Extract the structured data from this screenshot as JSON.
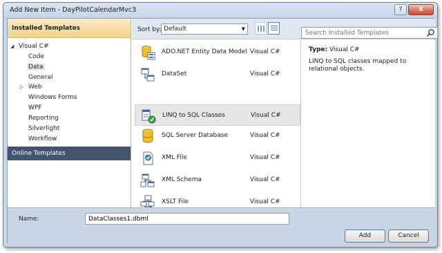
{
  "window": {
    "title": "Add New Item - DayPilotCalendarMvc3",
    "help_label": "?",
    "close_label": "X"
  },
  "left_pane": {
    "installed_header": "Installed Templates",
    "tree": [
      {
        "label": "Visual C#",
        "level": 0,
        "expanded": true
      },
      {
        "label": "Code",
        "level": 1
      },
      {
        "label": "Data",
        "level": 1,
        "selected": true
      },
      {
        "label": "General",
        "level": 1
      },
      {
        "label": "Web",
        "level": 1,
        "collapsed": true
      },
      {
        "label": "Windows Forms",
        "level": 1
      },
      {
        "label": "WPF",
        "level": 1
      },
      {
        "label": "Reporting",
        "level": 1
      },
      {
        "label": "Silverlight",
        "level": 1
      },
      {
        "label": "Workflow",
        "level": 1
      }
    ],
    "online_header": "Online Templates"
  },
  "toolbar": {
    "sort_label": "Sort by:",
    "sort_value": "Default",
    "search_placeholder": "Search Installed Templates"
  },
  "templates": [
    {
      "name": "ADO.NET Entity Data Model",
      "type": "Visual C#",
      "icon": "entity-model-icon"
    },
    {
      "name": "DataSet",
      "type": "Visual C#",
      "icon": "dataset-icon"
    },
    {
      "name": "LINQ to SQL Classes",
      "type": "Visual C#",
      "icon": "linq-to-sql-icon",
      "selected": true
    },
    {
      "name": "SQL Server Database",
      "type": "Visual C#",
      "icon": "database-icon"
    },
    {
      "name": "XML File",
      "type": "Visual C#",
      "icon": "xml-file-icon"
    },
    {
      "name": "XML Schema",
      "type": "Visual C#",
      "icon": "xml-schema-icon"
    },
    {
      "name": "XSLT File",
      "type": "Visual C#",
      "icon": "xslt-file-icon"
    }
  ],
  "details": {
    "type_label": "Type:",
    "type_value": "Visual C#",
    "description": "LINQ to SQL classes mapped to relational objects."
  },
  "footer": {
    "name_label": "Name:",
    "name_value": "DataClasses1.dbml",
    "add_label": "Add",
    "cancel_label": "Cancel"
  },
  "colors": {
    "accent": "#42546e",
    "installed_header": "#f5d48a",
    "dialog_background": "#c9d6e6"
  }
}
